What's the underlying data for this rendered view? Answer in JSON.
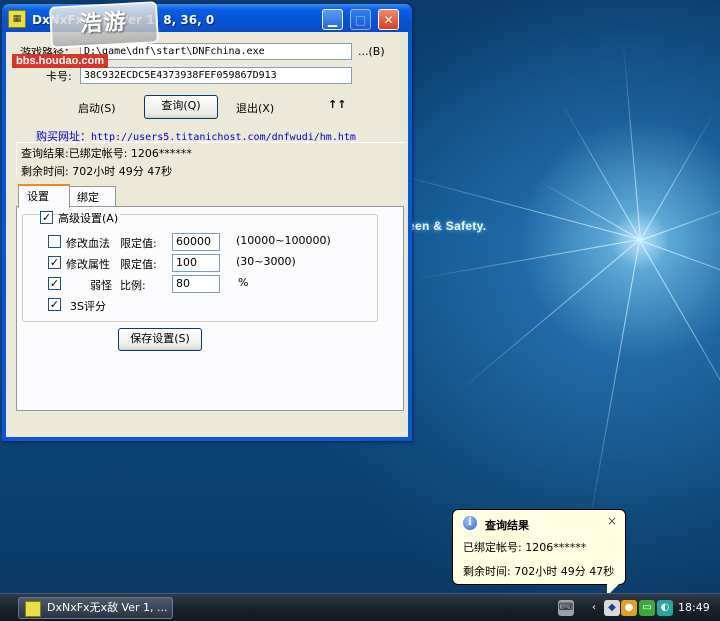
{
  "desktop": {
    "wallpaper_text": "een & Safety."
  },
  "watermark": {
    "logo_text": "浩游",
    "url": "bbs.houdao.com"
  },
  "window": {
    "title": "DxNxFx无x敌 Ver 1, 8, 36, 0",
    "game_path_label": "游戏路径：",
    "game_path_value": "D:\\game\\dnf\\start\\DNFchina.exe",
    "browse_label": "...(B)",
    "card_label": "卡号:",
    "card_value": "38C932ECDC5E4373938FEF059867D913",
    "start_label": "启动(S)",
    "query_label": "查询(Q)",
    "exit_label": "退出(X)",
    "arrows_label": "↑↑",
    "buy_label": "购买网址：",
    "buy_url": "http://users5.titanichost.com/dnfwudi/hm.htm",
    "result_line1": "查询结果:已绑定帐号: 1206******",
    "result_line2": "剩余时间: 702小时 49分 47秒",
    "tabs": [
      {
        "label": "设置"
      },
      {
        "label": "绑定"
      }
    ],
    "advanced_label": "高级设置(A)",
    "rows": [
      {
        "name": "修改血法",
        "limit_label": "限定值:",
        "value": "60000",
        "range": "(10000~100000)"
      },
      {
        "name": "修改属性",
        "limit_label": "限定值:",
        "value": "100",
        "range": "(30~3000)"
      },
      {
        "name": "弱怪",
        "limit_label": "比例:",
        "value": "80",
        "range": "%"
      },
      {
        "name": "3S评分"
      }
    ],
    "save_label": "保存设置(S)"
  },
  "balloon": {
    "title": "查询结果",
    "line1": "已绑定帐号: 1206******",
    "line2": "剩余时间: 702小时 49分 47秒",
    "close": "×"
  },
  "taskbar": {
    "task_label": "DxNxFx无x敌 Ver 1, ...",
    "clock": "18:49",
    "tray_chevron": "‹"
  }
}
